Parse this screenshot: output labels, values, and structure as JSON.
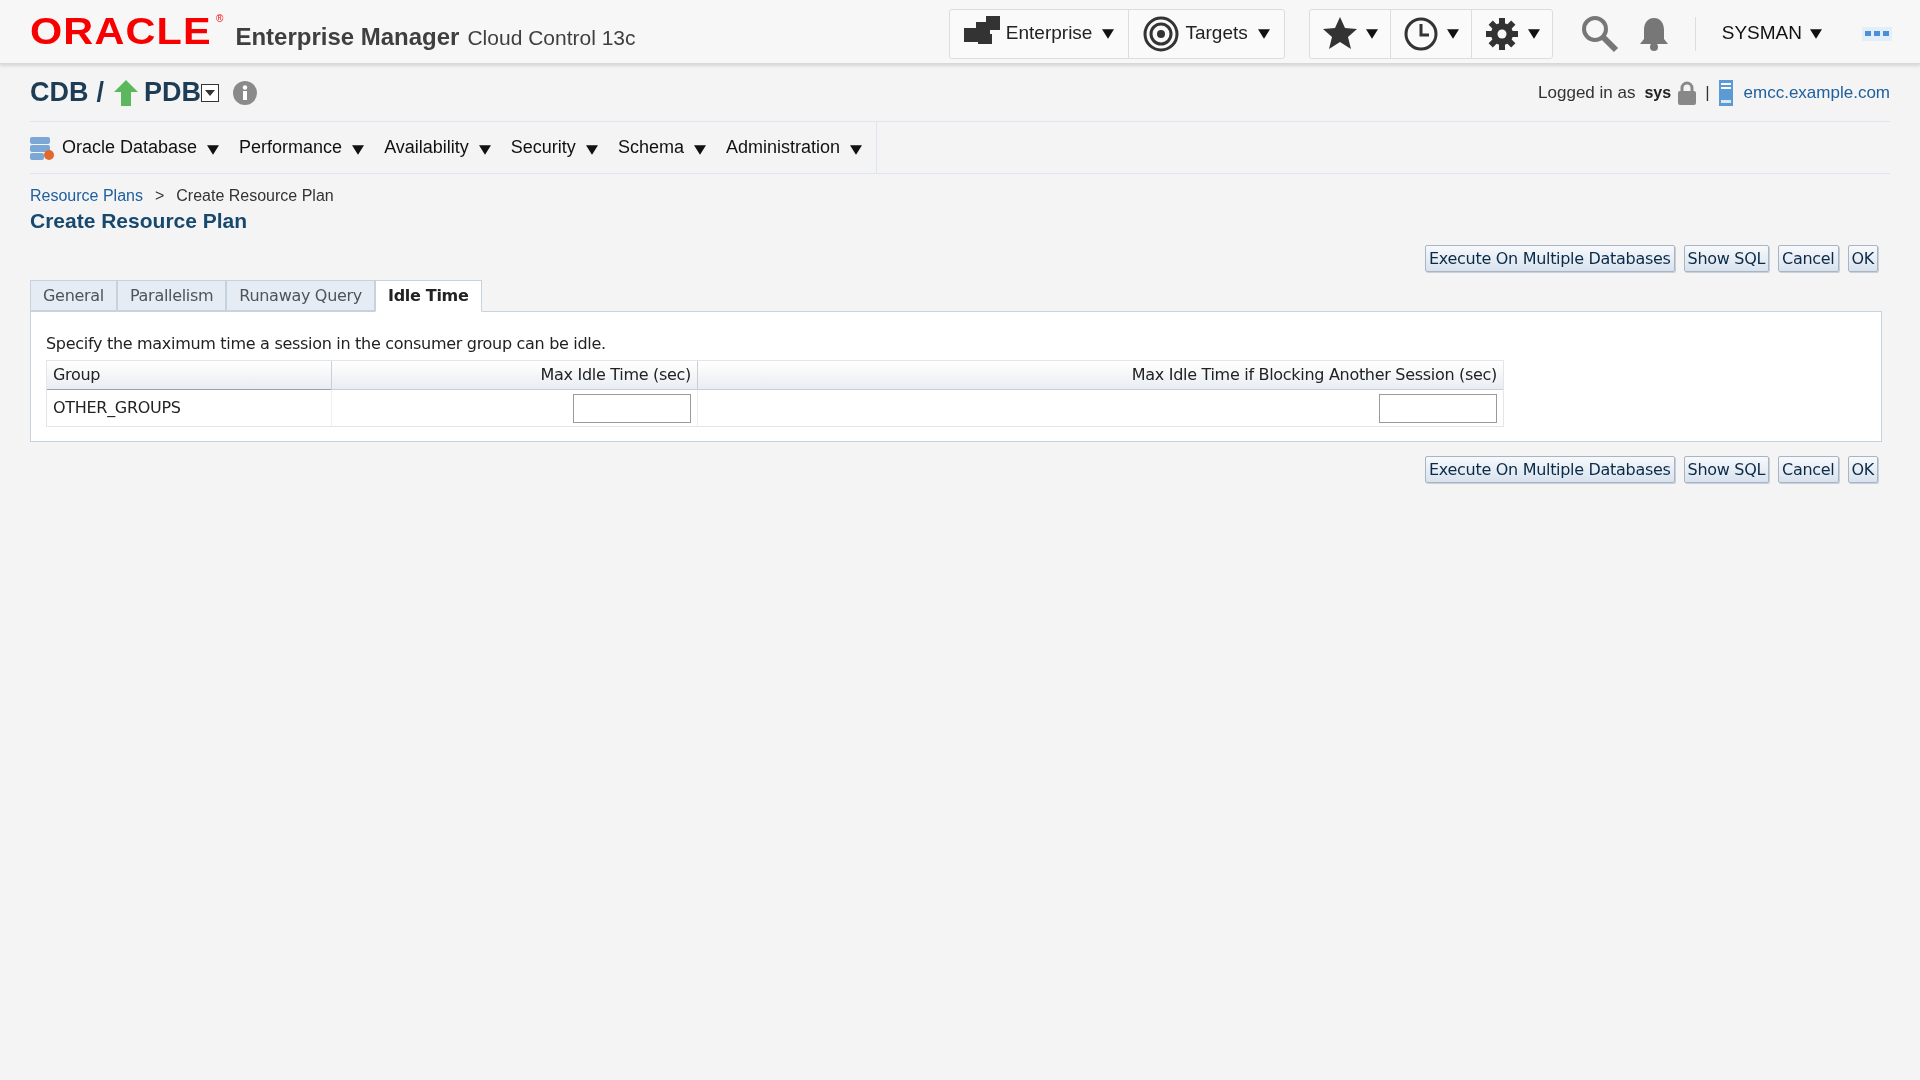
{
  "header": {
    "logo": "ORACLE",
    "logo_mark": "®",
    "product": "Enterprise Manager",
    "edition": "Cloud Control 13c",
    "nav": [
      {
        "label": "Enterprise",
        "kind": "enterprise"
      },
      {
        "label": "Targets",
        "kind": "targets"
      }
    ],
    "tools": [
      {
        "kind": "star"
      },
      {
        "kind": "clock"
      },
      {
        "kind": "gear"
      }
    ],
    "user": "SYSMAN"
  },
  "target": {
    "cdb": "CDB",
    "separator": "/",
    "pdb": "PDB",
    "logged_in_label": "Logged in as",
    "user": "sys",
    "divider": "|",
    "host": "emcc.example.com"
  },
  "menu": [
    {
      "label": "Oracle Database",
      "icon": true
    },
    {
      "label": "Performance",
      "icon": false
    },
    {
      "label": "Availability",
      "icon": false
    },
    {
      "label": "Security",
      "icon": false
    },
    {
      "label": "Schema",
      "icon": false
    },
    {
      "label": "Administration",
      "icon": false
    }
  ],
  "breadcrumb": [
    {
      "label": "Resource Plans",
      "link": true
    },
    {
      "label": ">",
      "link": false
    },
    {
      "label": "Create Resource Plan",
      "link": false
    }
  ],
  "page_title": "Create Resource Plan",
  "buttons_top": [
    "Execute On Multiple Databases",
    "Show SQL",
    "Cancel",
    "OK"
  ],
  "tabs": [
    {
      "label": "General",
      "selected": false
    },
    {
      "label": "Parallelism",
      "selected": false
    },
    {
      "label": "Runaway Query",
      "selected": false
    },
    {
      "label": "Idle Time",
      "selected": true
    }
  ],
  "description": "Specify the maximum time a session in the consumer group can be idle.",
  "table": {
    "columns": [
      "Group",
      "Max Idle Time (sec)",
      "Max Idle Time if Blocking Another Session (sec)"
    ],
    "rows": [
      {
        "group": "OTHER_GROUPS"
      }
    ]
  },
  "buttons_bottom": [
    "Execute On Multiple Databases",
    "Show SQL",
    "Cancel",
    "OK"
  ]
}
